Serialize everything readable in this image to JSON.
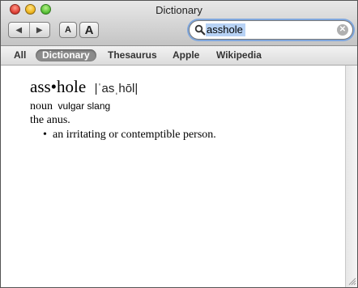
{
  "window": {
    "title": "Dictionary"
  },
  "toolbar": {
    "back_icon": "◀",
    "forward_icon": "▶",
    "font_smaller": "A",
    "font_larger": "A"
  },
  "search": {
    "value": "asshole",
    "clear_icon": "✕"
  },
  "scopes": [
    {
      "label": "All"
    },
    {
      "label": "Dictionary",
      "selected": true
    },
    {
      "label": "Thesaurus"
    },
    {
      "label": "Apple"
    },
    {
      "label": "Wikipedia"
    }
  ],
  "entry": {
    "headword": "ass•hole",
    "pronunciation": "|ˈasˌhōl|",
    "part_of_speech": "noun",
    "register": "vulgar slang",
    "definition_1": "the anus.",
    "bullet": "•",
    "definition_2": "an irritating or contemptible person."
  },
  "colors": {
    "accent": "#7fa6dc",
    "scope_selected": "#8b8b8b",
    "search_highlight": "#b7d2f5"
  }
}
